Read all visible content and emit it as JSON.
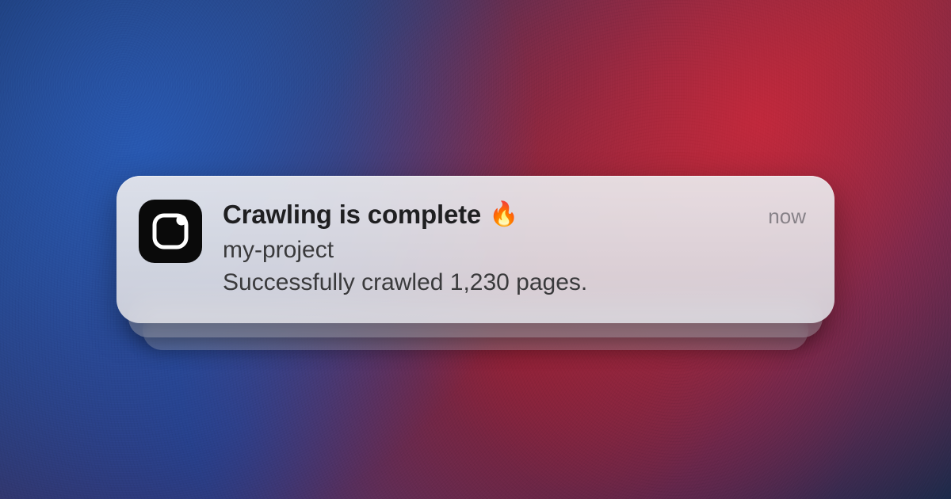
{
  "notification": {
    "title": "Crawling is complete",
    "title_emoji": "🔥",
    "app_name": "my-project",
    "body": "Successfully crawled 1,230 pages.",
    "timestamp": "now"
  }
}
